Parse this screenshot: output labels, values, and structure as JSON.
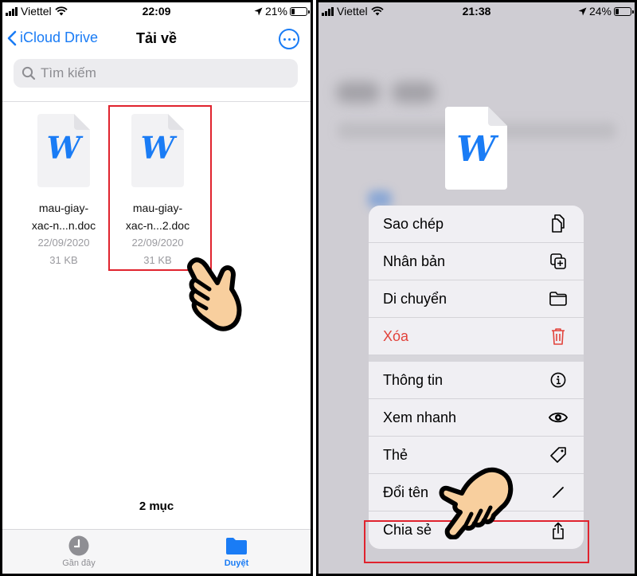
{
  "left_screen": {
    "status_bar": {
      "carrier": "Viettel",
      "time": "22:09",
      "battery": "21%"
    },
    "nav": {
      "back_label": "iCloud Drive",
      "title": "Tải về",
      "more_icon": "ellipsis-circle-icon"
    },
    "search": {
      "placeholder": "Tìm kiếm"
    },
    "files": [
      {
        "name_line1": "mau-giay-",
        "name_line2": "xac-n...n.doc",
        "date": "22/09/2020",
        "size": "31 KB",
        "icon_letter": "W"
      },
      {
        "name_line1": "mau-giay-",
        "name_line2": "xac-n...2.doc",
        "date": "22/09/2020",
        "size": "31 KB",
        "icon_letter": "W",
        "highlighted": true
      }
    ],
    "item_count": "2 mục",
    "tabs": [
      {
        "label": "Gần đây",
        "icon": "clock-icon",
        "active": false
      },
      {
        "label": "Duyệt",
        "icon": "folder-icon",
        "active": true
      }
    ]
  },
  "right_screen": {
    "status_bar": {
      "carrier": "Viettel",
      "time": "21:38",
      "battery": "24%"
    },
    "preview": {
      "icon_letter": "W"
    },
    "menu": {
      "group1": [
        {
          "label": "Sao chép",
          "icon": "copy-icon"
        },
        {
          "label": "Nhân bản",
          "icon": "duplicate-icon"
        },
        {
          "label": "Di chuyển",
          "icon": "folder-icon"
        },
        {
          "label": "Xóa",
          "icon": "trash-icon",
          "destructive": true
        }
      ],
      "group2": [
        {
          "label": "Thông tin",
          "icon": "info-icon"
        },
        {
          "label": "Xem nhanh",
          "icon": "eye-icon"
        },
        {
          "label": "Thẻ",
          "icon": "tag-icon"
        },
        {
          "label": "Đổi tên",
          "icon": "pencil-icon"
        },
        {
          "label": "Chia sẻ",
          "icon": "share-icon",
          "highlighted": true
        }
      ]
    }
  },
  "colors": {
    "accent": "#1a7cf5",
    "highlight": "#e0232e",
    "destructive": "#e2423b",
    "hand_fill": "#f8cf9e"
  }
}
